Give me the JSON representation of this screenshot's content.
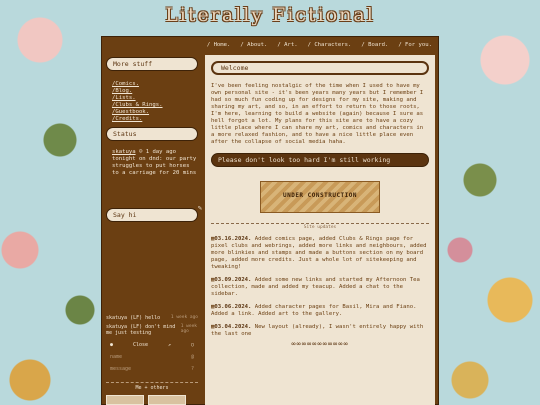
{
  "site": {
    "title": "Literally Fictional"
  },
  "nav": [
    "/ Home.",
    "/ About.",
    "/ Art.",
    "/ Characters.",
    "/ Board.",
    "/ For you."
  ],
  "sidebar": {
    "more_stuff_title": "More stuff",
    "links": [
      "/Comics.",
      "/Blog.",
      "/Lists.",
      "/Clubs & Rings.",
      "/Guestbook.",
      "/Credits."
    ],
    "status_title": "Status",
    "status_user": "skatuya",
    "status_time": "1 day ago",
    "status_body": "tonight on dnd: our party struggles to put horses to a carriage for 20 mins",
    "say_hi_title": "Say hi",
    "chat": [
      {
        "name": "skatuya (LF)",
        "text": "hello",
        "time": "1 week ago"
      },
      {
        "name": "skatuya (LF)",
        "text": "don't mind me just testing",
        "time": "1 week ago"
      }
    ],
    "chat_close": "Close",
    "chat_name_placeholder": "name",
    "chat_message_placeholder": "message",
    "me_others": "Me + others"
  },
  "main": {
    "welcome_title": "Welcome",
    "intro": "I've been feeling nostalgic of the time when I used to have my own personal site - it's been years many years but I remember I had so much fun coding up for designs for my site, making and sharing my art, and so, in an effort to return to those roots, I'm here, learning to build a website (again) because I sure as hell forgot a lot. My plans for this site are to have a cozy little place where I can share my art, comics and characters in a more relaxed fashion, and to have a nice little place even after the collapse of social media haha.",
    "warning": "Please don't look too hard I'm still working",
    "construction_label": "UNDER CONSTRUCTION",
    "updates_title": "Site updates",
    "updates": [
      {
        "date": "03.16.2024.",
        "text": "Added comics page, added Clubs & Rings page for pixel clubs and webrings, added more links and neighbours, added more blinkies and stamps and made a buttons section on my board page, added more credits. Just a whole lot of sitekeeping and tweaking!"
      },
      {
        "date": "03.09.2024.",
        "text": "Added some new links and started my Afternoon Tea collection, made and added my teacup. Added a chat to the sidebar."
      },
      {
        "date": "03.06.2024.",
        "text": "Added character pages for Basil, Mira and Fiano. Added a link. Added art to the gallery."
      },
      {
        "date": "03.04.2024.",
        "text": "New layout (already), I wasn't entirely happy with the last one"
      }
    ]
  }
}
